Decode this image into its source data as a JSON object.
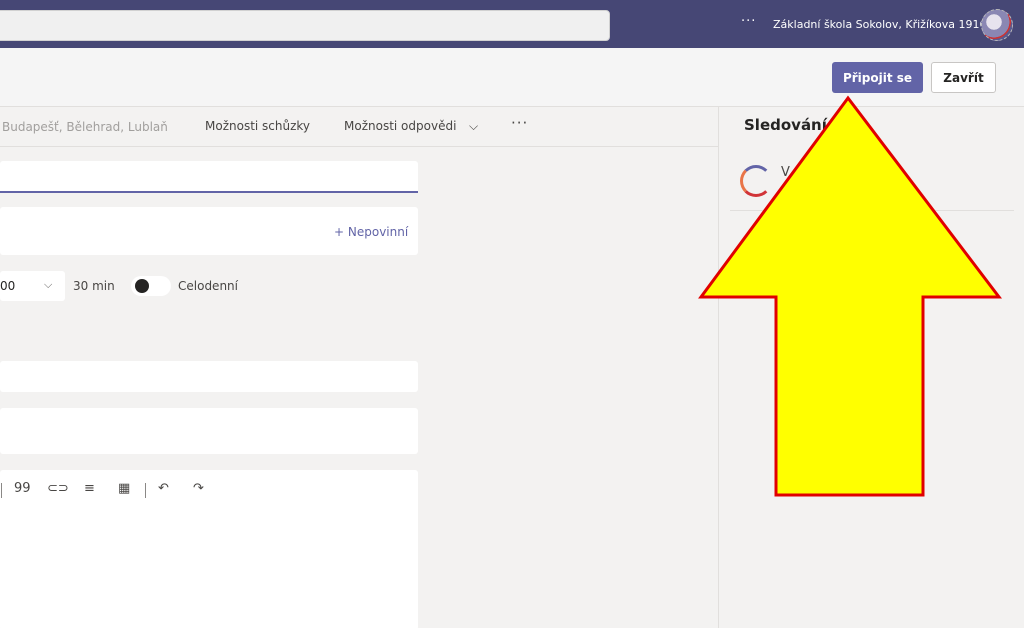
{
  "titlebar": {
    "more_label": "···",
    "organization": "Základní škola Sokolov, Křižíkova 1916",
    "avatar_icon": "avatar-image"
  },
  "actions": {
    "join_label": "Připojit se",
    "close_label": "Zavřít"
  },
  "toolbar": {
    "timezone": "Budapešť, Bělehrad, Lublaň",
    "meeting_options": "Možnosti schůzky",
    "response_options": "Možnosti odpovědi",
    "response_chevron": "⌵",
    "more": "···"
  },
  "form": {
    "optional_label": "+ Nepovinní",
    "start_time": "00",
    "time_chevron": "⌵",
    "duration": "30 min",
    "all_day_label": "Celodenní",
    "all_day_on": false
  },
  "editor_toolbar": [
    {
      "icon": "quote-icon",
      "glyph": "99"
    },
    {
      "icon": "link-icon",
      "glyph": "⊂⊃"
    },
    {
      "icon": "align-icon",
      "glyph": "≡"
    },
    {
      "icon": "table-icon",
      "glyph": "▦"
    },
    {
      "icon": "undo-icon",
      "glyph": "↶"
    },
    {
      "icon": "redo-icon",
      "glyph": "↷"
    }
  ],
  "side": {
    "title": "Sledování",
    "attendee_name": "V"
  },
  "colors": {
    "accent": "#6264a7",
    "titlebar": "#464775",
    "arrow_fill": "#ffff00",
    "arrow_stroke": "#e00000"
  }
}
